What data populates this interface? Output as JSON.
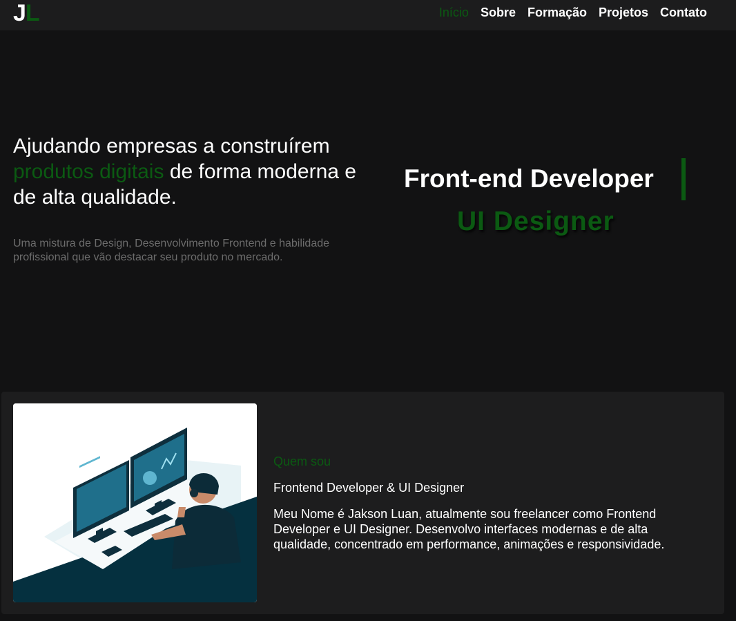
{
  "logo": {
    "letter1": "J",
    "letter2": "L"
  },
  "nav": {
    "items": [
      {
        "label": "Início",
        "active": true
      },
      {
        "label": "Sobre",
        "active": false
      },
      {
        "label": "Formação",
        "active": false
      },
      {
        "label": "Projetos",
        "active": false
      },
      {
        "label": "Contato",
        "active": false
      }
    ]
  },
  "hero": {
    "heading_part1": "Ajudando empresas a construírem",
    "heading_accent": "produtos digitais",
    "heading_part2": "de forma moderna e de alta qualidade.",
    "subtitle": "Uma mistura de Design, Desenvolvimento Frontend e habilidade profissional que vão destacar seu produto no mercado.",
    "role_primary": "Front-end Developer",
    "role_secondary": "UI Designer"
  },
  "about": {
    "image_icon": "developer-at-computer-illustration",
    "eyebrow": "Quem sou",
    "title": "Frontend Developer & UI Designer",
    "text": "Meu Nome é Jakson Luan, atualmente sou freelancer como Frontend Developer e UI Designer. Desenvolvo interfaces modernas e de alta qualidade, concentrado em performance, animações e responsividade."
  },
  "colors": {
    "background": "#121213",
    "navbar": "#1c1c1d",
    "accent": "#0b5a12",
    "muted_text": "#6c6c6c",
    "card": "#1d1d1e"
  }
}
